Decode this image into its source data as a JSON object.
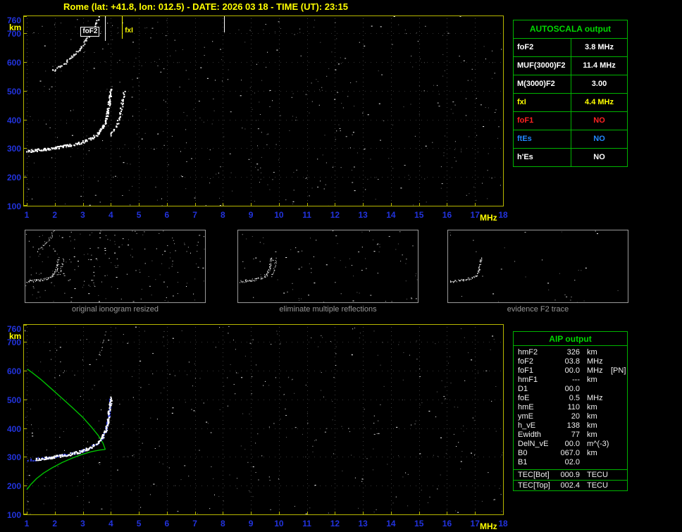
{
  "header": {
    "title": "Rome (lat: +41.8, lon: 012.5) - DATE: 2026 03 18 - TIME (UT): 23:15"
  },
  "colors": {
    "accent_yellow": "#ffff00",
    "axis_blue": "#2233dd",
    "panel_green": "#00b400",
    "trace_white": "#ffffff",
    "profile_green": "#00c000",
    "restored_blue": "#3344ee",
    "status_red": "#ff2222",
    "status_blue": "#2288ff"
  },
  "autoscala_table": {
    "title": "AUTOSCALA output",
    "rows": [
      {
        "label": "foF2",
        "value": "3.8 MHz",
        "color": "#ffffff"
      },
      {
        "label": "MUF(3000)F2",
        "value": "11.4 MHz",
        "color": "#ffffff"
      },
      {
        "label": "M(3000)F2",
        "value": "3.00",
        "color": "#ffffff"
      },
      {
        "label": "fxI",
        "value": "4.4 MHz",
        "color": "#ffff00"
      },
      {
        "label": "foF1",
        "value": "NO",
        "color": "#ff2222"
      },
      {
        "label": "ftEs",
        "value": "NO",
        "color": "#2288ff"
      },
      {
        "label": "h'Es",
        "value": "NO",
        "color": "#ffffff"
      }
    ]
  },
  "aip_table": {
    "title": "AIP output",
    "rows": [
      {
        "name": "hmF2",
        "value": "326",
        "unit": "km",
        "extra": ""
      },
      {
        "name": "foF2",
        "value": "03.8",
        "unit": "MHz",
        "extra": ""
      },
      {
        "name": "foF1",
        "value": "00.0",
        "unit": "MHz",
        "extra": "[PN]"
      },
      {
        "name": "hmF1",
        "value": "---",
        "unit": "km",
        "extra": ""
      },
      {
        "name": "D1",
        "value": "00.0",
        "unit": "",
        "extra": ""
      },
      {
        "name": "foE",
        "value": "0.5",
        "unit": "MHz",
        "extra": ""
      },
      {
        "name": "hmE",
        "value": "110",
        "unit": "km",
        "extra": ""
      },
      {
        "name": "ymE",
        "value": "20",
        "unit": "km",
        "extra": ""
      },
      {
        "name": "h_vE",
        "value": "138",
        "unit": "km",
        "extra": ""
      },
      {
        "name": "Ewidth",
        "value": "77",
        "unit": "km",
        "extra": ""
      },
      {
        "name": "DelN_vE",
        "value": "00.0",
        "unit": "m^(-3)",
        "extra": ""
      },
      {
        "name": "B0",
        "value": "067.0",
        "unit": "km",
        "extra": ""
      },
      {
        "name": "B1",
        "value": "02.0",
        "unit": "",
        "extra": ""
      }
    ],
    "tec_rows": [
      {
        "name": "TEC[Bot]",
        "value": "000.9",
        "unit": "TECU",
        "extra": ""
      },
      {
        "name": "TEC[Top]",
        "value": "002.4",
        "unit": "TECU",
        "extra": ""
      }
    ]
  },
  "thumbnails": [
    {
      "caption": "original ionogram resized",
      "series": [
        0,
        1,
        2
      ],
      "noise": {
        "white": 120,
        "gray": 70
      },
      "seed": 5
    },
    {
      "caption": "eliminate multiple reflections",
      "series": [
        0,
        1
      ],
      "noise": {
        "white": 55,
        "gray": 35
      },
      "seed": 6
    },
    {
      "caption": "evidence F2 trace",
      "series": [
        0
      ],
      "noise": {
        "white": 20,
        "gray": 12
      },
      "seed": 7
    }
  ],
  "chart_data": [
    {
      "id": "scaled-ionogram",
      "type": "scatter",
      "title": "autoscaled ionogram with foF2 and fxI markers",
      "xlabel": "MHz",
      "ylabel": "km",
      "xlim": [
        1,
        18
      ],
      "ylim": [
        100,
        760
      ],
      "xticks": [
        1,
        2,
        3,
        4,
        5,
        6,
        7,
        8,
        9,
        10,
        11,
        12,
        13,
        14,
        15,
        16,
        17,
        18
      ],
      "yticks": [
        760,
        700,
        600,
        500,
        400,
        300,
        200,
        100
      ],
      "seed": 42,
      "noise": {
        "white": 230,
        "gray": 190
      },
      "markers": [
        {
          "name": "fof2",
          "label": "foF2",
          "freq": 3.8,
          "color": "#ffffff",
          "len": 35,
          "boxed": true
        },
        {
          "name": "fxi",
          "label": "fxI",
          "freq": 4.4,
          "color": "#ffff00",
          "len": 32,
          "boxed": false
        },
        {
          "name": "interference",
          "label": "",
          "freq": 8.05,
          "color": "#ffffff",
          "len": 23,
          "boxed": false
        }
      ],
      "series": [
        {
          "name": "F2 trace O-mode",
          "style": "dots",
          "color": "#ffffff",
          "size": 2,
          "density": 2,
          "points": [
            [
              1.0,
              292
            ],
            [
              1.3,
              295
            ],
            [
              1.6,
              298
            ],
            [
              1.9,
              302
            ],
            [
              2.2,
              307
            ],
            [
              2.5,
              312
            ],
            [
              2.8,
              319
            ],
            [
              3.1,
              328
            ],
            [
              3.35,
              340
            ],
            [
              3.55,
              355
            ],
            [
              3.7,
              374
            ],
            [
              3.8,
              398
            ],
            [
              3.87,
              428
            ],
            [
              3.92,
              458
            ],
            [
              3.96,
              486
            ],
            [
              4.0,
              508
            ]
          ]
        },
        {
          "name": "F2 trace X-mode",
          "style": "dots",
          "color": "#ffffff",
          "size": 2,
          "density": 1,
          "points": [
            [
              3.95,
              345
            ],
            [
              4.1,
              365
            ],
            [
              4.22,
              392
            ],
            [
              4.32,
              425
            ],
            [
              4.4,
              462
            ],
            [
              4.45,
              500
            ]
          ]
        },
        {
          "name": "second reflection",
          "style": "dots",
          "color": "#e8e8e8",
          "size": 2,
          "density": 1,
          "points": [
            [
              1.9,
              570
            ],
            [
              2.15,
              585
            ],
            [
              2.4,
              603
            ],
            [
              2.65,
              625
            ],
            [
              2.9,
              650
            ],
            [
              3.1,
              676
            ],
            [
              3.3,
              706
            ],
            [
              3.45,
              735
            ],
            [
              3.55,
              758
            ]
          ]
        }
      ]
    },
    {
      "id": "profile-ionogram",
      "type": "scatter",
      "title": "ionogram with restored F2 trace and electron density profile",
      "xlabel": "MHz",
      "ylabel": "km",
      "xlim": [
        1,
        18
      ],
      "ylim": [
        100,
        760
      ],
      "xticks": [
        1,
        2,
        3,
        4,
        5,
        6,
        7,
        8,
        9,
        10,
        11,
        12,
        13,
        14,
        15,
        16,
        17,
        18
      ],
      "yticks": [
        760,
        700,
        600,
        500,
        400,
        300,
        200,
        100
      ],
      "seed": 77,
      "noise": {
        "white": 190,
        "gray": 150
      },
      "markers": [],
      "series": [
        {
          "name": "electron density profile",
          "style": "line",
          "color": "#00c000",
          "width": 1.4,
          "points": [
            [
              1.0,
              186
            ],
            [
              1.15,
              205
            ],
            [
              1.35,
              225
            ],
            [
              1.6,
              244
            ],
            [
              1.9,
              262
            ],
            [
              2.25,
              280
            ],
            [
              2.6,
              295
            ],
            [
              2.95,
              308
            ],
            [
              3.3,
              318
            ],
            [
              3.6,
              324
            ],
            [
              3.78,
              326
            ],
            [
              3.8,
              327
            ],
            [
              3.72,
              348
            ],
            [
              3.55,
              375
            ],
            [
              3.3,
              405
            ],
            [
              3.0,
              438
            ],
            [
              2.65,
              470
            ],
            [
              2.25,
              505
            ],
            [
              1.85,
              540
            ],
            [
              1.5,
              570
            ],
            [
              1.2,
              593
            ],
            [
              1.02,
              606
            ]
          ]
        },
        {
          "name": "restored F2 trace",
          "style": "dots",
          "color": "#3344ee",
          "size": 2,
          "density": 1,
          "points": [
            [
              1.05,
              290
            ],
            [
              1.4,
              295
            ],
            [
              1.8,
              300
            ],
            [
              2.2,
              306
            ],
            [
              2.6,
              313
            ],
            [
              3.0,
              323
            ],
            [
              3.3,
              336
            ],
            [
              3.55,
              352
            ],
            [
              3.72,
              372
            ],
            [
              3.82,
              398
            ],
            [
              3.88,
              425
            ],
            [
              3.92,
              452
            ],
            [
              3.95,
              478
            ],
            [
              3.97,
              505
            ]
          ]
        },
        {
          "name": "F2 trace",
          "style": "dots",
          "color": "#ffffff",
          "size": 2,
          "density": 2,
          "points": [
            [
              1.3,
              293
            ],
            [
              1.6,
              297
            ],
            [
              1.9,
              301
            ],
            [
              2.2,
              306
            ],
            [
              2.5,
              311
            ],
            [
              2.8,
              318
            ],
            [
              3.1,
              327
            ],
            [
              3.35,
              339
            ],
            [
              3.55,
              354
            ],
            [
              3.7,
              373
            ],
            [
              3.8,
              397
            ],
            [
              3.87,
              427
            ],
            [
              3.92,
              457
            ],
            [
              3.96,
              485
            ],
            [
              4.0,
              507
            ]
          ]
        },
        {
          "name": "second reflection remnants",
          "style": "points",
          "color": "#dddddd",
          "size": 1,
          "points": [
            [
              2.0,
              578
            ],
            [
              2.15,
              587
            ],
            [
              2.3,
              596
            ],
            [
              3.5,
              640
            ],
            [
              3.56,
              655
            ],
            [
              3.62,
              668
            ],
            [
              3.68,
              682
            ],
            [
              3.72,
              696
            ],
            [
              3.76,
              710
            ],
            [
              3.8,
              724
            ],
            [
              3.83,
              738
            ]
          ]
        }
      ]
    }
  ]
}
